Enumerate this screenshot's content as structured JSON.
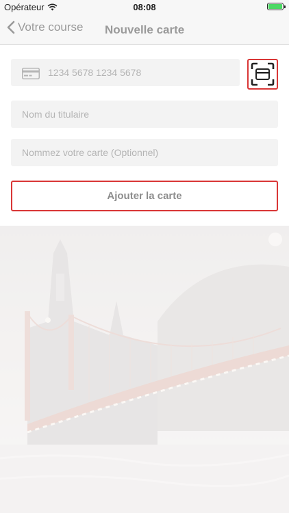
{
  "status_bar": {
    "carrier": "Opérateur",
    "time": "08:08"
  },
  "nav": {
    "back_label": "Votre course",
    "title": "Nouvelle carte"
  },
  "form": {
    "card_number_placeholder": "1234 5678 1234 5678",
    "holder_placeholder": "Nom du titulaire",
    "nickname_placeholder": "Nommez votre carte (Optionnel)",
    "add_button_label": "Ajouter la carte"
  },
  "colors": {
    "accent": "#d93636",
    "field_bg": "#f3f3f3",
    "nav_bg": "#f7f7f7",
    "battery": "#4cd964"
  },
  "icons": {
    "back": "chevron-left-icon",
    "card": "credit-card-icon",
    "scan": "card-scan-icon",
    "wifi": "wifi-icon",
    "battery": "battery-icon"
  }
}
